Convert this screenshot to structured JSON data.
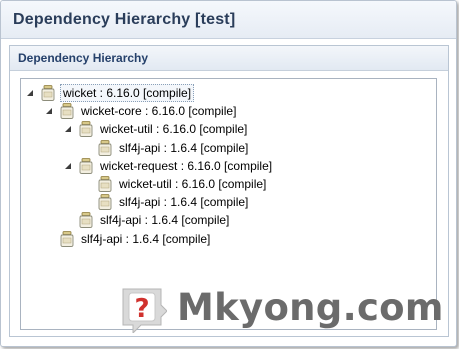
{
  "window": {
    "title": "Dependency Hierarchy [test]"
  },
  "section": {
    "title": "Dependency Hierarchy"
  },
  "tree": [
    {
      "label": "wicket : 6.16.0 [compile]",
      "depth": 0,
      "expanded": true,
      "selected": true
    },
    {
      "label": "wicket-core : 6.16.0 [compile]",
      "depth": 1,
      "expanded": true,
      "selected": false
    },
    {
      "label": "wicket-util : 6.16.0 [compile]",
      "depth": 2,
      "expanded": true,
      "selected": false
    },
    {
      "label": "slf4j-api : 1.6.4 [compile]",
      "depth": 3,
      "expanded": null,
      "selected": false
    },
    {
      "label": "wicket-request : 6.16.0 [compile]",
      "depth": 2,
      "expanded": true,
      "selected": false
    },
    {
      "label": "wicket-util : 6.16.0 [compile]",
      "depth": 3,
      "expanded": null,
      "selected": false
    },
    {
      "label": "slf4j-api : 1.6.4 [compile]",
      "depth": 3,
      "expanded": null,
      "selected": false
    },
    {
      "label": "slf4j-api : 1.6.4 [compile]",
      "depth": 2,
      "expanded": null,
      "selected": false
    },
    {
      "label": "slf4j-api : 1.6.4 [compile]",
      "depth": 1,
      "expanded": null,
      "selected": false
    }
  ],
  "icons": {
    "node": "jar-icon",
    "expand": "expanded-triangle-icon",
    "logo": "mkyong-logo-icon"
  },
  "colors": {
    "title": "#2a3d5a",
    "section_title": "#26416b",
    "watermark": "#6b6b6b",
    "logo_red": "#d0312d"
  },
  "watermark": {
    "text": "Mkyong.com"
  }
}
